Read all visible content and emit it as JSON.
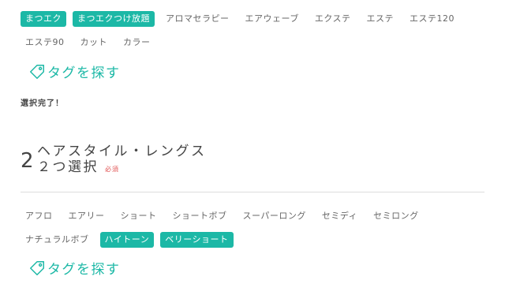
{
  "section1": {
    "tags": [
      {
        "label": "まつエク",
        "selected": true
      },
      {
        "label": "まつエクつけ放題",
        "selected": true
      },
      {
        "label": "アロマセラピー",
        "selected": false
      },
      {
        "label": "エアウェーブ",
        "selected": false
      },
      {
        "label": "エクステ",
        "selected": false
      },
      {
        "label": "エステ",
        "selected": false
      },
      {
        "label": "エステ120",
        "selected": false
      },
      {
        "label": "エステ90",
        "selected": false
      },
      {
        "label": "カット",
        "selected": false
      },
      {
        "label": "カラー",
        "selected": false
      }
    ],
    "find_label": "タグを探す",
    "complete_text": "選択完了！"
  },
  "section2": {
    "number": "2",
    "title": "ヘアスタイル・レングス",
    "subtitle": "２つ選択",
    "required": "必須",
    "tags": [
      {
        "label": "アフロ",
        "selected": false
      },
      {
        "label": "エアリー",
        "selected": false
      },
      {
        "label": "ショート",
        "selected": false
      },
      {
        "label": "ショートボブ",
        "selected": false
      },
      {
        "label": "スーパーロング",
        "selected": false
      },
      {
        "label": "セミディ",
        "selected": false
      },
      {
        "label": "セミロング",
        "selected": false
      },
      {
        "label": "ナチュラルボブ",
        "selected": false
      },
      {
        "label": "ハイトーン",
        "selected": true
      },
      {
        "label": "ベリーショート",
        "selected": true
      }
    ],
    "find_label": "タグを探す"
  },
  "colors": {
    "accent": "#1cb8a6",
    "required": "#e05050"
  },
  "icons": {
    "find": "tag-icon"
  }
}
